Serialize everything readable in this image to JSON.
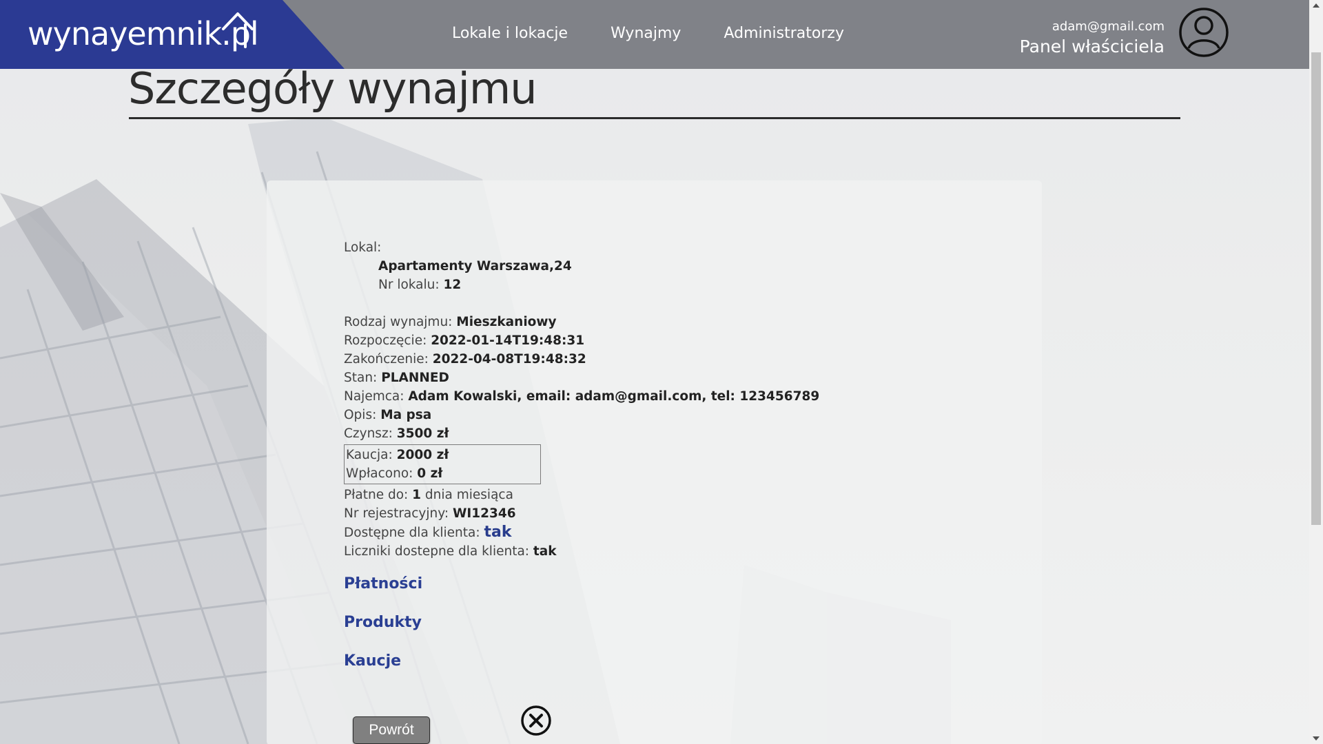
{
  "header": {
    "logo": "wynayemnik.pl",
    "nav": [
      "Lokale i lokacje",
      "Wynajmy",
      "Administratorzy"
    ],
    "user_email": "adam@gmail.com",
    "user_panel": "Panel właściciela",
    "avatar_icon": "user-circle-icon"
  },
  "page": {
    "title": "Szczegóły wynajmu"
  },
  "details": {
    "lokal_label": "Lokal:",
    "lokal_name": "Apartamenty Warszawa,24",
    "nr_lokalu_label": "Nr lokalu: ",
    "nr_lokalu": "12",
    "rodzaj_label": "Rodzaj wynajmu: ",
    "rodzaj": "Mieszkaniowy",
    "start_label": "Rozpoczęcie: ",
    "start": "2022-01-14T19:48:31",
    "end_label": "Zakończenie: ",
    "end": "2022-04-08T19:48:32",
    "stan_label": "Stan: ",
    "stan": "PLANNED",
    "najemca_label": "Najemca: ",
    "najemca": "Adam Kowalski, email: adam@gmail.com, tel: 123456789",
    "opis_label": "Opis: ",
    "opis": "Ma psa",
    "czynsz_label": "Czynsz: ",
    "czynsz": "3500 zł",
    "kaucja_label": "Kaucja: ",
    "kaucja": "2000 zł",
    "wplacono_label": "Wpłacono: ",
    "wplacono": "0 zł",
    "platne_label": "Płatne do: ",
    "platne_day": "1",
    "platne_suffix": " dnia miesiąca",
    "nr_rej_label": "Nr rejestracyjny: ",
    "nr_rej": "WI12346",
    "dostepne_label": "Dostępne dla klienta: ",
    "dostepne": "tak",
    "liczniki_label": "Liczniki dostepne dla klienta: ",
    "liczniki": "tak"
  },
  "links": {
    "platnosci": "Płatności",
    "produkty": "Produkty",
    "kaucje": "Kaucje"
  },
  "actions": {
    "back": "Powrót",
    "close_icon": "close-circle-icon"
  },
  "colors": {
    "navbar": "#808288",
    "logo_bg": "#2b3a93",
    "link": "#2a3f93",
    "button": "#808080"
  }
}
